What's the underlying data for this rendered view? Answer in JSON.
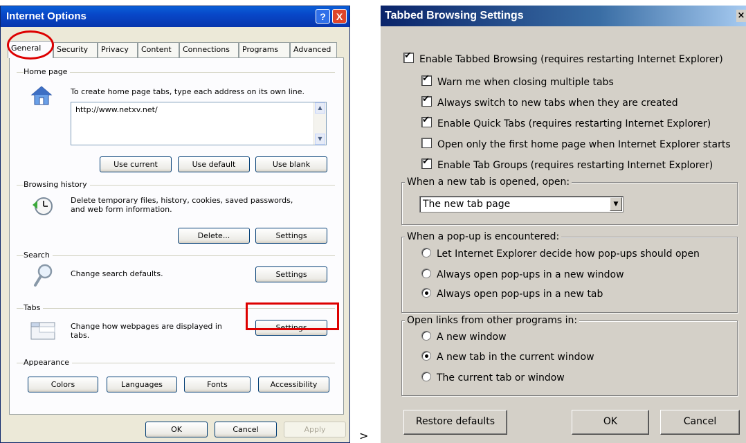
{
  "internet_options": {
    "title": "Internet Options",
    "help_label": "?",
    "close_label": "X",
    "tabs": [
      "General",
      "Security",
      "Privacy",
      "Content",
      "Connections",
      "Programs",
      "Advanced"
    ],
    "home_page": {
      "label": "Home page",
      "description": "To create home page tabs, type each address on its own line.",
      "url": "http://www.netxv.net/",
      "buttons": [
        "Use current",
        "Use default",
        "Use blank"
      ]
    },
    "browsing_history": {
      "label": "Browsing history",
      "description_line1": "Delete temporary files, history, cookies, saved passwords,",
      "description_line2": "and web form information.",
      "buttons": [
        "Delete...",
        "Settings"
      ]
    },
    "search": {
      "label": "Search",
      "description": "Change search defaults.",
      "button": "Settings"
    },
    "tabs_section": {
      "label": "Tabs",
      "description_line1": "Change how webpages are displayed in",
      "description_line2": "tabs.",
      "button": "Settings"
    },
    "appearance": {
      "label": "Appearance",
      "buttons": [
        "Colors",
        "Languages",
        "Fonts",
        "Accessibility"
      ]
    },
    "footer": {
      "ok": "OK",
      "cancel": "Cancel",
      "apply": "Apply"
    }
  },
  "separator": ">",
  "tabbed_browsing": {
    "title": "Tabbed Browsing Settings",
    "close_label": "×",
    "enable": {
      "label": "Enable Tabbed Browsing (requires restarting Internet Explorer)",
      "checked": true
    },
    "options": [
      {
        "label": "Warn me when closing multiple tabs",
        "checked": true
      },
      {
        "label": "Always switch to new tabs when they are created",
        "checked": true
      },
      {
        "label": "Enable Quick Tabs (requires restarting Internet Explorer)",
        "checked": true
      },
      {
        "label": "Open only the first home page when Internet Explorer starts",
        "checked": false
      },
      {
        "label": "Enable Tab Groups (requires restarting Internet Explorer)",
        "checked": true
      }
    ],
    "new_tab": {
      "legend": "When a new tab is opened, open:",
      "selected": "The new tab page"
    },
    "popup": {
      "legend": "When a pop-up is encountered:",
      "options": [
        {
          "label": "Let Internet Explorer decide how pop-ups should open",
          "selected": false
        },
        {
          "label": "Always open pop-ups in a new window",
          "selected": false
        },
        {
          "label": "Always open pop-ups in a new tab",
          "selected": true
        }
      ]
    },
    "links": {
      "legend": "Open links from other programs in:",
      "options": [
        {
          "label": "A new window",
          "selected": false
        },
        {
          "label": "A new tab in the current window",
          "selected": true
        },
        {
          "label": "The current tab or window",
          "selected": false
        }
      ]
    },
    "buttons": {
      "restore": "Restore defaults",
      "ok": "OK",
      "cancel": "Cancel"
    }
  },
  "colors": {
    "xp_title": "#0a5fd8",
    "classic_title": "#0a246a",
    "highlight": "#dd0000"
  }
}
